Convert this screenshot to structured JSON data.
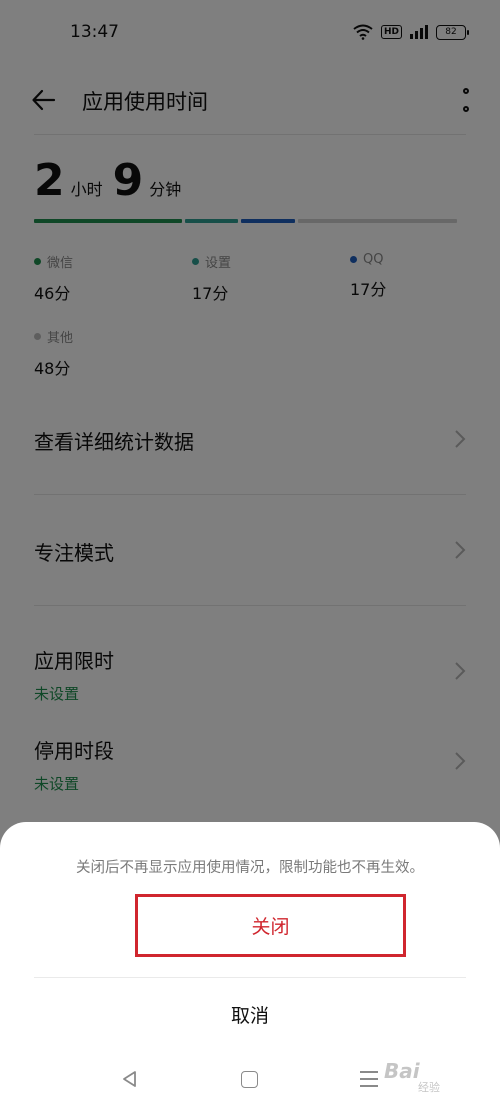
{
  "status_bar": {
    "time": "13:47",
    "hd": "HD",
    "battery": "82"
  },
  "app_bar": {
    "title": "应用使用时间"
  },
  "total": {
    "hours": "2",
    "hours_unit": "小时",
    "minutes": "9",
    "minutes_unit": "分钟"
  },
  "usage_segments": [
    {
      "name": "微信",
      "fraction": 0.35,
      "color": "#1e8f4e"
    },
    {
      "name": "设置",
      "fraction": 0.13,
      "color": "#2f9f92"
    },
    {
      "name": "QQ",
      "fraction": 0.13,
      "color": "#1f5fbf"
    },
    {
      "name": "其他",
      "fraction": 0.37,
      "color": "#d0d0d0"
    }
  ],
  "legend": [
    {
      "name": "微信",
      "value": "46分",
      "color": "#1e8f4e"
    },
    {
      "name": "设置",
      "value": "17分",
      "color": "#2f9f92"
    },
    {
      "name": "QQ",
      "value": "17分",
      "color": "#1f5fbf"
    },
    {
      "name": "其他",
      "value": "48分",
      "color": "#bdbdbd"
    }
  ],
  "rows": {
    "details": "查看详细统计数据",
    "focus": "专注模式",
    "app_limit": {
      "title": "应用限时",
      "status": "未设置"
    },
    "downtime": {
      "title": "停用时段",
      "status": "未设置"
    }
  },
  "sheet": {
    "message": "关闭后不再显示应用使用情况，限制功能也不再生效。",
    "close_label": "关闭",
    "cancel_label": "取消"
  },
  "watermark": {
    "text": "Bai",
    "sub": "经验"
  }
}
